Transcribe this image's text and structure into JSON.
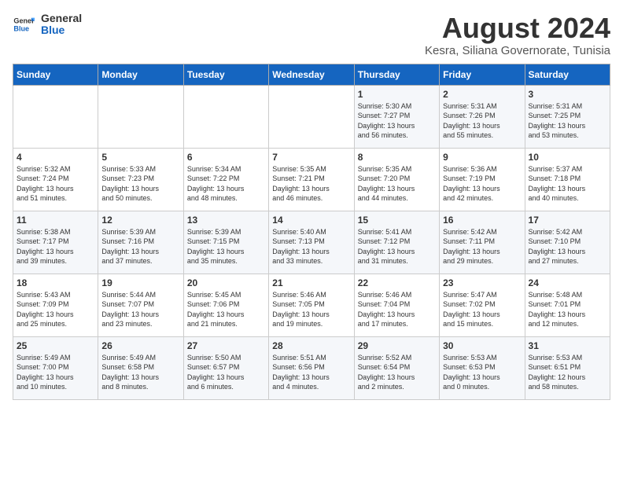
{
  "logo": {
    "text_general": "General",
    "text_blue": "Blue"
  },
  "title": "August 2024",
  "subtitle": "Kesra, Siliana Governorate, Tunisia",
  "days_of_week": [
    "Sunday",
    "Monday",
    "Tuesday",
    "Wednesday",
    "Thursday",
    "Friday",
    "Saturday"
  ],
  "weeks": [
    [
      {
        "day": "",
        "info": ""
      },
      {
        "day": "",
        "info": ""
      },
      {
        "day": "",
        "info": ""
      },
      {
        "day": "",
        "info": ""
      },
      {
        "day": "1",
        "info": "Sunrise: 5:30 AM\nSunset: 7:27 PM\nDaylight: 13 hours\nand 56 minutes."
      },
      {
        "day": "2",
        "info": "Sunrise: 5:31 AM\nSunset: 7:26 PM\nDaylight: 13 hours\nand 55 minutes."
      },
      {
        "day": "3",
        "info": "Sunrise: 5:31 AM\nSunset: 7:25 PM\nDaylight: 13 hours\nand 53 minutes."
      }
    ],
    [
      {
        "day": "4",
        "info": "Sunrise: 5:32 AM\nSunset: 7:24 PM\nDaylight: 13 hours\nand 51 minutes."
      },
      {
        "day": "5",
        "info": "Sunrise: 5:33 AM\nSunset: 7:23 PM\nDaylight: 13 hours\nand 50 minutes."
      },
      {
        "day": "6",
        "info": "Sunrise: 5:34 AM\nSunset: 7:22 PM\nDaylight: 13 hours\nand 48 minutes."
      },
      {
        "day": "7",
        "info": "Sunrise: 5:35 AM\nSunset: 7:21 PM\nDaylight: 13 hours\nand 46 minutes."
      },
      {
        "day": "8",
        "info": "Sunrise: 5:35 AM\nSunset: 7:20 PM\nDaylight: 13 hours\nand 44 minutes."
      },
      {
        "day": "9",
        "info": "Sunrise: 5:36 AM\nSunset: 7:19 PM\nDaylight: 13 hours\nand 42 minutes."
      },
      {
        "day": "10",
        "info": "Sunrise: 5:37 AM\nSunset: 7:18 PM\nDaylight: 13 hours\nand 40 minutes."
      }
    ],
    [
      {
        "day": "11",
        "info": "Sunrise: 5:38 AM\nSunset: 7:17 PM\nDaylight: 13 hours\nand 39 minutes."
      },
      {
        "day": "12",
        "info": "Sunrise: 5:39 AM\nSunset: 7:16 PM\nDaylight: 13 hours\nand 37 minutes."
      },
      {
        "day": "13",
        "info": "Sunrise: 5:39 AM\nSunset: 7:15 PM\nDaylight: 13 hours\nand 35 minutes."
      },
      {
        "day": "14",
        "info": "Sunrise: 5:40 AM\nSunset: 7:13 PM\nDaylight: 13 hours\nand 33 minutes."
      },
      {
        "day": "15",
        "info": "Sunrise: 5:41 AM\nSunset: 7:12 PM\nDaylight: 13 hours\nand 31 minutes."
      },
      {
        "day": "16",
        "info": "Sunrise: 5:42 AM\nSunset: 7:11 PM\nDaylight: 13 hours\nand 29 minutes."
      },
      {
        "day": "17",
        "info": "Sunrise: 5:42 AM\nSunset: 7:10 PM\nDaylight: 13 hours\nand 27 minutes."
      }
    ],
    [
      {
        "day": "18",
        "info": "Sunrise: 5:43 AM\nSunset: 7:09 PM\nDaylight: 13 hours\nand 25 minutes."
      },
      {
        "day": "19",
        "info": "Sunrise: 5:44 AM\nSunset: 7:07 PM\nDaylight: 13 hours\nand 23 minutes."
      },
      {
        "day": "20",
        "info": "Sunrise: 5:45 AM\nSunset: 7:06 PM\nDaylight: 13 hours\nand 21 minutes."
      },
      {
        "day": "21",
        "info": "Sunrise: 5:46 AM\nSunset: 7:05 PM\nDaylight: 13 hours\nand 19 minutes."
      },
      {
        "day": "22",
        "info": "Sunrise: 5:46 AM\nSunset: 7:04 PM\nDaylight: 13 hours\nand 17 minutes."
      },
      {
        "day": "23",
        "info": "Sunrise: 5:47 AM\nSunset: 7:02 PM\nDaylight: 13 hours\nand 15 minutes."
      },
      {
        "day": "24",
        "info": "Sunrise: 5:48 AM\nSunset: 7:01 PM\nDaylight: 13 hours\nand 12 minutes."
      }
    ],
    [
      {
        "day": "25",
        "info": "Sunrise: 5:49 AM\nSunset: 7:00 PM\nDaylight: 13 hours\nand 10 minutes."
      },
      {
        "day": "26",
        "info": "Sunrise: 5:49 AM\nSunset: 6:58 PM\nDaylight: 13 hours\nand 8 minutes."
      },
      {
        "day": "27",
        "info": "Sunrise: 5:50 AM\nSunset: 6:57 PM\nDaylight: 13 hours\nand 6 minutes."
      },
      {
        "day": "28",
        "info": "Sunrise: 5:51 AM\nSunset: 6:56 PM\nDaylight: 13 hours\nand 4 minutes."
      },
      {
        "day": "29",
        "info": "Sunrise: 5:52 AM\nSunset: 6:54 PM\nDaylight: 13 hours\nand 2 minutes."
      },
      {
        "day": "30",
        "info": "Sunrise: 5:53 AM\nSunset: 6:53 PM\nDaylight: 13 hours\nand 0 minutes."
      },
      {
        "day": "31",
        "info": "Sunrise: 5:53 AM\nSunset: 6:51 PM\nDaylight: 12 hours\nand 58 minutes."
      }
    ]
  ]
}
